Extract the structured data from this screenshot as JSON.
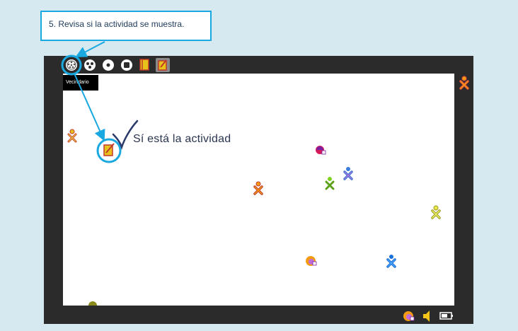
{
  "callout": {
    "text": "5. Revisa si la actividad  se muestra."
  },
  "toolbar": {
    "items": [
      {
        "name": "neighborhood-view",
        "icon": "neighborhood-icon"
      },
      {
        "name": "group-view",
        "icon": "group-icon"
      },
      {
        "name": "home-view",
        "icon": "home-icon"
      },
      {
        "name": "activity-view",
        "icon": "activity-icon"
      },
      {
        "name": "journal",
        "icon": "journal-icon"
      },
      {
        "name": "write-activity",
        "icon": "write-activity-icon"
      }
    ],
    "tooltip": "Vecindario"
  },
  "annotation": {
    "note": "Sí está la actividad",
    "check": "checkmark-icon"
  },
  "tray": {
    "items": [
      "network-icon",
      "speaker-icon",
      "battery-icon"
    ]
  },
  "colors": {
    "accent": "#1aa8e0",
    "frame": "#2b2b2b",
    "background": "#d7e9f0"
  }
}
